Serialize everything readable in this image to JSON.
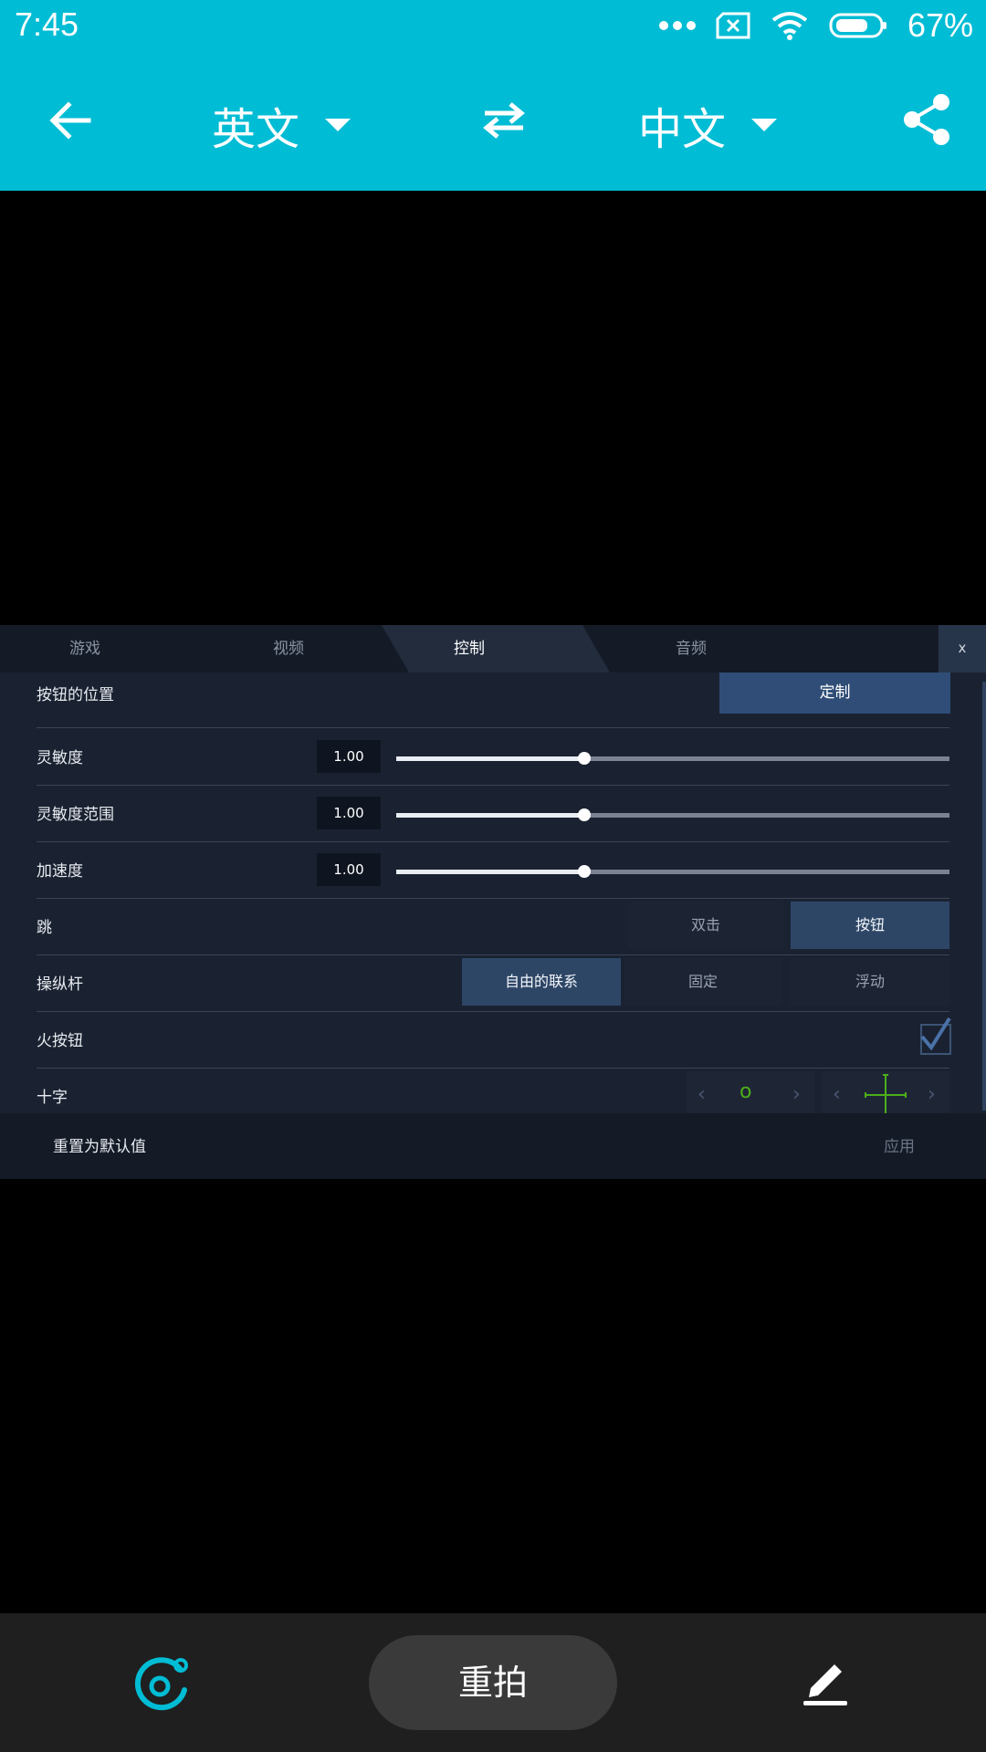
{
  "status": {
    "time": "7:45",
    "battery": "67%"
  },
  "toolbar": {
    "source_lang": "英文",
    "target_lang": "中文"
  },
  "game": {
    "tabs": [
      "游戏",
      "视频",
      "控制",
      "音频"
    ],
    "close": "x",
    "rows": {
      "button_position": "按钮的位置",
      "custom": "定制",
      "sensitivity": "灵敏度",
      "sensitivity_value": "1.00",
      "sensitivity_level": 0.34,
      "sensitivity_range": "灵敏度范围",
      "sensitivity_range_value": "1.00",
      "sensitivity_range_level": 0.34,
      "acceleration": "加速度",
      "acceleration_value": "1.00",
      "acceleration_level": 0.34,
      "jump": "跳",
      "jump_double_tap": "双击",
      "jump_button": "按钮",
      "joystick": "操纵杆",
      "joystick_free": "自由的联系",
      "joystick_fixed": "固定",
      "joystick_float": "浮动",
      "fire_button": "火按钮",
      "crosshair": "十字",
      "crosshair_style": "o"
    },
    "footer": {
      "reset": "重置为默认值",
      "apply": "应用"
    }
  },
  "bottom": {
    "retake": "重拍"
  },
  "colors": {
    "accent": "#00bcd4",
    "panel": "#1a2231",
    "selected": "#2f4d76",
    "crosshair": "#4caf1a"
  }
}
